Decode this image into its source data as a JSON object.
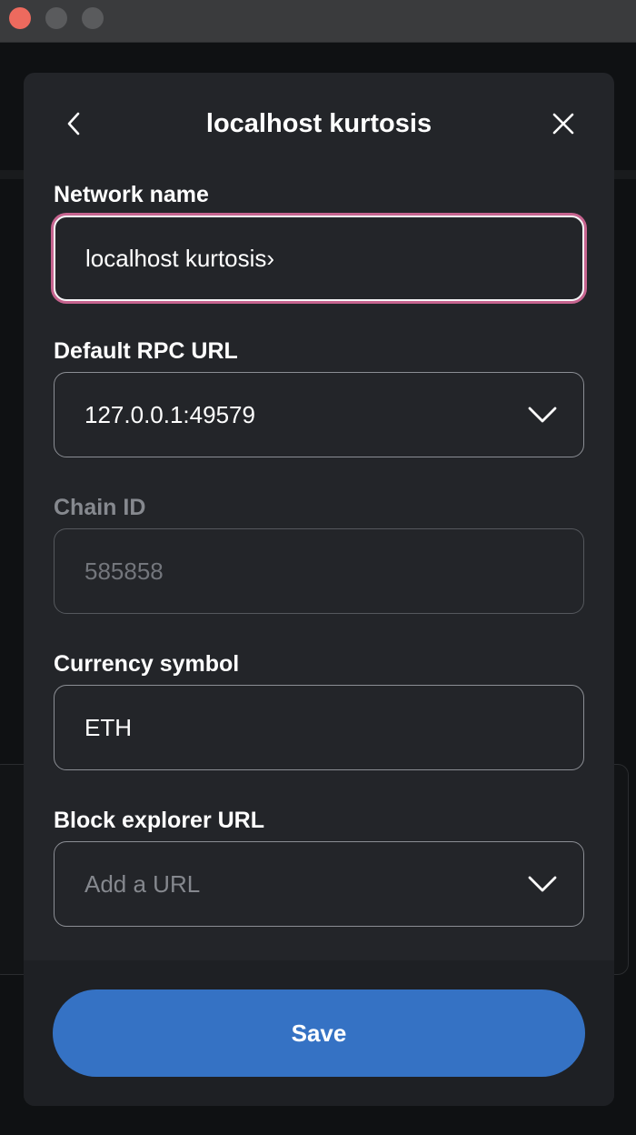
{
  "window": {
    "controls": [
      "close",
      "minimize",
      "zoom"
    ]
  },
  "header": {
    "title": "localhost kurtosis",
    "back_icon": "chevron-left-icon",
    "close_icon": "close-icon"
  },
  "form": {
    "network_name": {
      "label": "Network name",
      "value": "localhost kurtosis›"
    },
    "rpc_url": {
      "label": "Default RPC URL",
      "value": "127.0.0.1:49579"
    },
    "chain_id": {
      "label": "Chain ID",
      "value": "585858"
    },
    "currency_symbol": {
      "label": "Currency symbol",
      "value": "ETH"
    },
    "block_explorer": {
      "label": "Block explorer URL",
      "placeholder": "Add a URL"
    }
  },
  "footer": {
    "save_label": "Save"
  },
  "colors": {
    "accent": "#3572c4",
    "focus_ring": "#c6648f",
    "modal_bg": "#232529"
  }
}
